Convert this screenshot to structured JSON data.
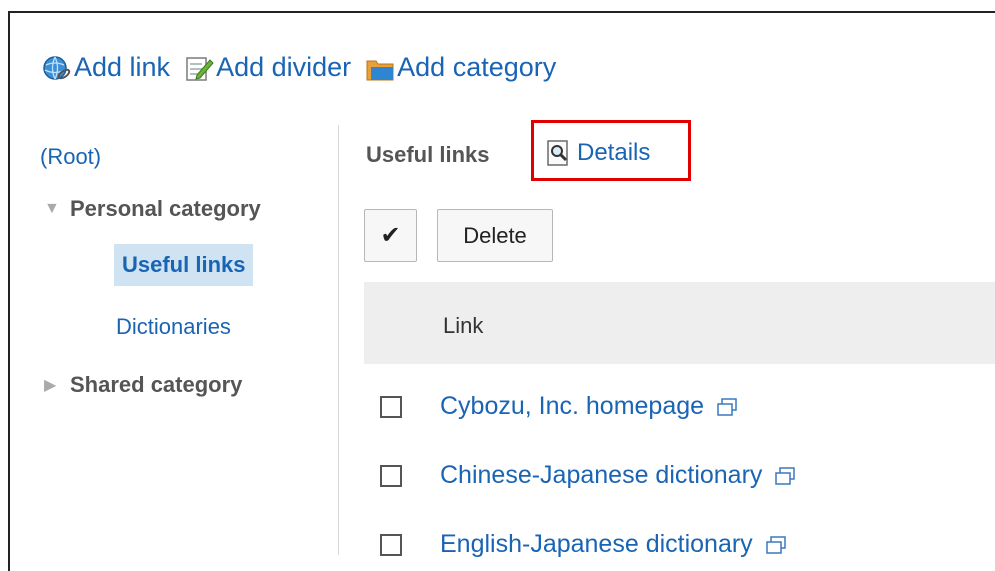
{
  "toolbar": {
    "add_link": "Add link",
    "add_divider": "Add divider",
    "add_category": "Add category"
  },
  "sidebar": {
    "root": "(Root)",
    "personal_category": "Personal category",
    "personal_items": [
      "Useful links",
      "Dictionaries"
    ],
    "shared_category": "Shared category"
  },
  "main": {
    "title": "Useful links",
    "details": "Details",
    "check_all_symbol": "✔",
    "delete_label": "Delete",
    "column_link": "Link",
    "rows": [
      {
        "label": "Cybozu, Inc. homepage"
      },
      {
        "label": "Chinese-Japanese dictionary"
      },
      {
        "label": "English-Japanese dictionary"
      }
    ]
  },
  "colors": {
    "link": "#1a64b4",
    "highlight_border": "#e00000",
    "selected_bg": "#cfe3f3",
    "header_bg": "#eeeeee"
  }
}
